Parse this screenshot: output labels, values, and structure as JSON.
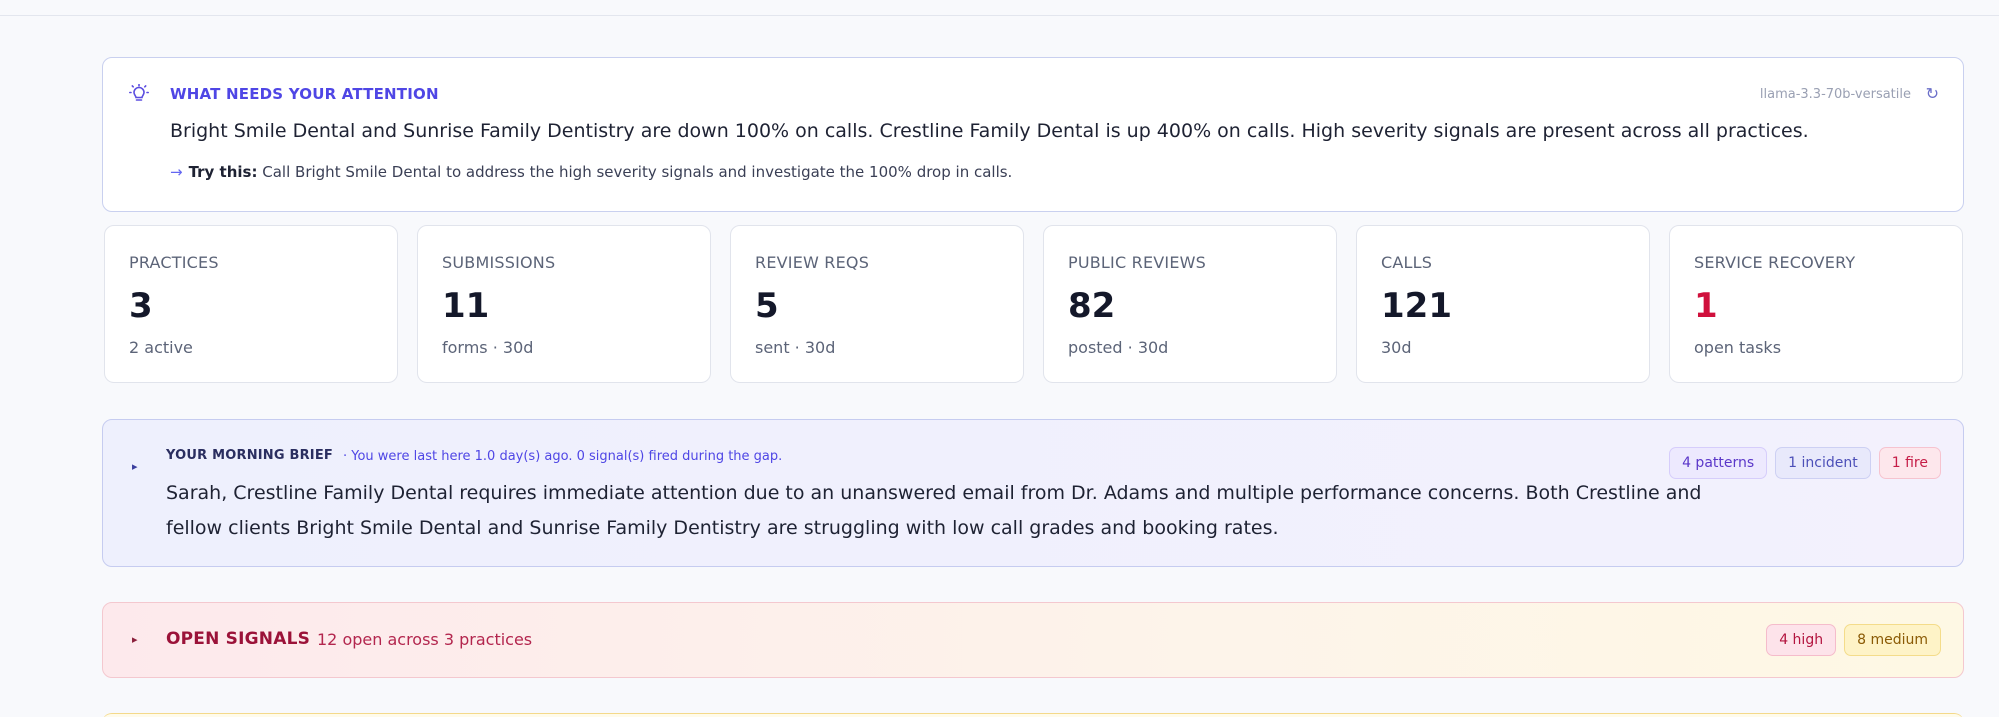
{
  "attention": {
    "heading": "WHAT NEEDS YOUR ATTENTION",
    "model": "llama-3.3-70b-versatile",
    "summary": "Bright Smile Dental and Sunrise Family Dentistry are down 100% on calls. Crestline Family Dental is up 400% on calls. High severity signals are present across all practices.",
    "try_label": "Try this:",
    "try_text": "Call Bright Smile Dental to address the high severity signals and investigate the 100% drop in calls.",
    "icon": "lightbulb-icon"
  },
  "stats": [
    {
      "label": "PRACTICES",
      "value": "3",
      "sub": "2 active"
    },
    {
      "label": "SUBMISSIONS",
      "value": "11",
      "sub": "forms · 30d"
    },
    {
      "label": "REVIEW REQS",
      "value": "5",
      "sub": "sent · 30d"
    },
    {
      "label": "PUBLIC REVIEWS",
      "value": "82",
      "sub": "posted · 30d"
    },
    {
      "label": "CALLS",
      "value": "121",
      "sub": "30d"
    },
    {
      "label": "SERVICE RECOVERY",
      "value": "1",
      "sub": "open tasks",
      "color": "#d0103c"
    }
  ],
  "brief": {
    "heading": "YOUR MORNING BRIEF",
    "gap_note": "· You were last here 1.0 day(s) ago. 0 signal(s) fired during the gap.",
    "text": "Sarah, Crestline Family Dental requires immediate attention due to an unanswered email from Dr. Adams and multiple performance concerns. Both Crestline and fellow clients Bright Smile Dental and Sunrise Family Dentistry are struggling with low call grades and booking rates.",
    "badges": [
      "4 patterns",
      "1 incident",
      "1 fire"
    ]
  },
  "signals": {
    "heading": "OPEN SIGNALS",
    "count": "12 open across 3 practices",
    "badges": [
      "4 high",
      "8 medium"
    ]
  },
  "colors": {
    "accent": "#4f46e5",
    "danger": "#d0103c",
    "signals_text": "#9b1239"
  }
}
